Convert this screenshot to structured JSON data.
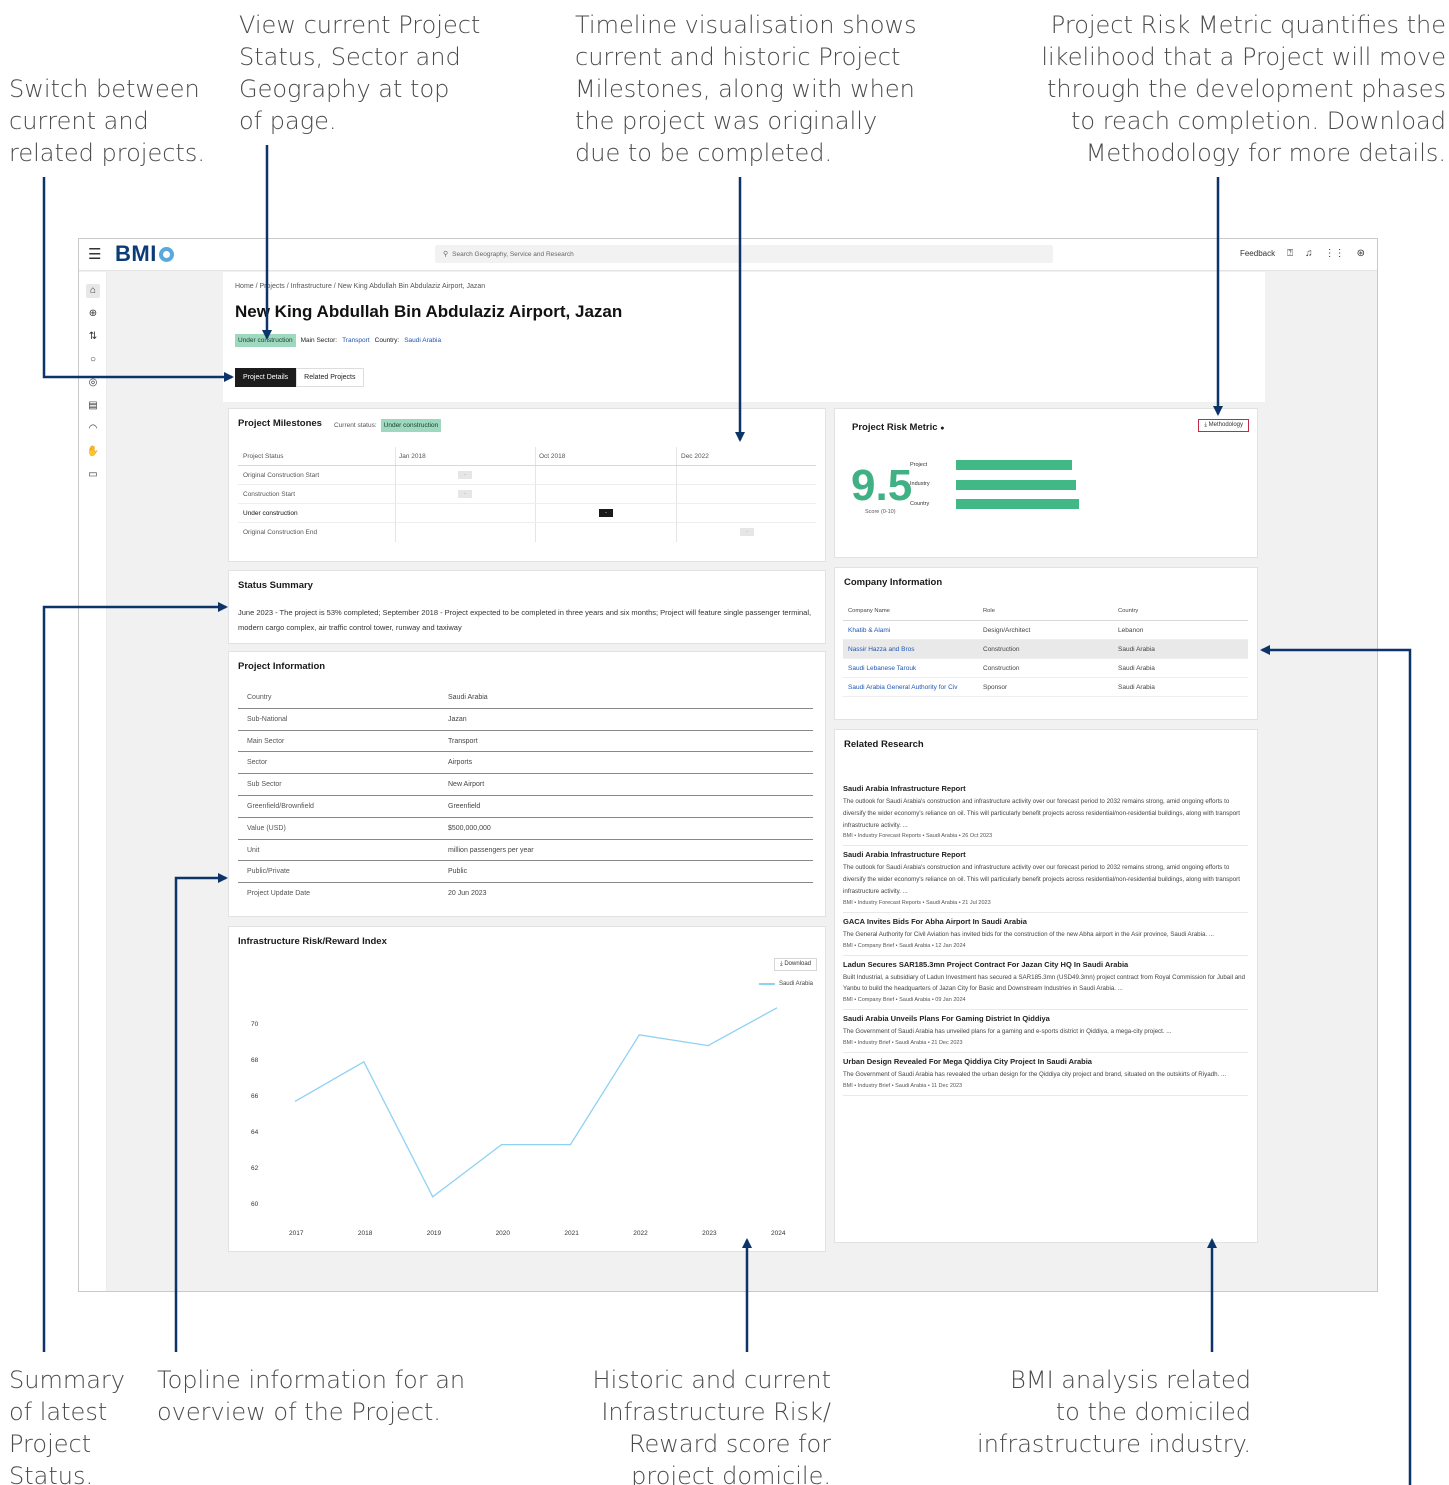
{
  "annotations": {
    "switch": "Switch between\ncurrent and\nrelated projects.",
    "view_status": "View current Project\nStatus, Sector and\nGeography at top\nof page.",
    "timeline": "Timeline visualisation shows\ncurrent and historic Project\nMilestones, along with when\nthe project was originally\ndue to be completed.",
    "risk_metric": "Project Risk Metric quantifies the\nlikelihood that a Project will move\nthrough the development phases\nto reach completion. Download\nMethodology for more details.",
    "summary": "Summary\nof latest\nProject\nStatus.",
    "topline": "Topline information for an\noverview of the Project.",
    "historic": "Historic and current\nInfrastructure Risk/\nReward score for\nproject domicile.",
    "bmi_analysis": "BMI analysis related\nto the domiciled\ninfrastructure industry."
  },
  "topbar": {
    "logo": "BMI",
    "search_placeholder": "Search Geography, Service and Research",
    "feedback": "Feedback"
  },
  "header": {
    "breadcrumb": "Home  /  Projects  /  Infrastructure  /  New King Abdullah Bin Abdulaziz Airport, Jazan",
    "title": "New King Abdullah Bin Abdulaziz Airport, Jazan",
    "status_badge": "Under construction",
    "main_sector_label": "Main Sector:",
    "main_sector": "Transport",
    "country_label": "Country:",
    "country": "Saudi Arabia",
    "tabs": [
      "Project Details",
      "Related Projects"
    ]
  },
  "milestones": {
    "title": "Project Milestones",
    "current_status_label": "Current status:",
    "current_status": "Under construction",
    "col_header": "Project Status",
    "dates": [
      "Jan 2018",
      "Oct 2018",
      "Dec 2022"
    ],
    "rows": [
      "Original Construction Start",
      "Construction Start",
      "Under construction",
      "Original Construction End"
    ],
    "marker": "-"
  },
  "risk": {
    "title": "Project Risk Metric",
    "methodology": "Methodology",
    "score": "9.5",
    "score_caption": "Score (0-10)",
    "bars": [
      {
        "label": "Project",
        "value": 0.93
      },
      {
        "label": "Industry",
        "value": 0.96
      },
      {
        "label": "Country",
        "value": 0.98
      }
    ],
    "color": "#42b887"
  },
  "summary": {
    "title": "Status Summary",
    "text": "June 2023 - The project is 53% completed; September 2018 - Project expected to be completed in three years and six months; Project will feature single passenger terminal, modern cargo complex, air traffic control tower, runway and taxiway"
  },
  "project_info": {
    "title": "Project Information",
    "rows": [
      {
        "k": "Country",
        "v": "Saudi Arabia"
      },
      {
        "k": "Sub-National",
        "v": "Jazan"
      },
      {
        "k": "Main Sector",
        "v": "Transport"
      },
      {
        "k": "Sector",
        "v": "Airports"
      },
      {
        "k": "Sub Sector",
        "v": "New Airport"
      },
      {
        "k": "Greenfield/Brownfield",
        "v": "Greenfield"
      },
      {
        "k": "Value (USD)",
        "v": "$500,000,000"
      },
      {
        "k": "Unit",
        "v": "million passengers per year"
      },
      {
        "k": "Public/Private",
        "v": "Public"
      },
      {
        "k": "Project Update Date",
        "v": "20 Jun 2023"
      }
    ]
  },
  "company": {
    "title": "Company Information",
    "headers": [
      "Company Name",
      "Role",
      "Country"
    ],
    "rows": [
      {
        "name": "Khatib & Alami",
        "role": "Design/Architect",
        "country": "Lebanon"
      },
      {
        "name": "Nassir Hazza and Bros",
        "role": "Construction",
        "country": "Saudi Arabia"
      },
      {
        "name": "Saudi Lebanese Tarouk",
        "role": "Construction",
        "country": "Saudi Arabia"
      },
      {
        "name": "Saudi Arabia General Authority for Civ",
        "role": "Sponsor",
        "country": "Saudi Arabia"
      }
    ]
  },
  "research": {
    "title": "Related Research",
    "items": [
      {
        "title": "Saudi Arabia Infrastructure Report",
        "body": "The outlook for Saudi Arabia's construction and infrastructure activity over our forecast period to 2032 remains strong, amid ongoing efforts to diversify the wider economy's reliance on oil. This will particularly benefit projects across residential/non-residential buildings, along with transport infrastructure activity. ...",
        "meta": "BMI  •  Industry Forecast Reports  •  Saudi Arabia  •  26 Oct 2023"
      },
      {
        "title": "Saudi Arabia Infrastructure Report",
        "body": "The outlook for Saudi Arabia's construction and infrastructure activity over our forecast period to 2032 remains strong, amid ongoing efforts to diversify the wider economy's reliance on oil. This will particularly benefit projects across residential/non-residential buildings, along with transport infrastructure activity. ...",
        "meta": "BMI  •  Industry Forecast Reports  •  Saudi Arabia  •  21 Jul 2023"
      },
      {
        "title": "GACA Invites Bids For Abha Airport In Saudi Arabia",
        "body": "The General Authority for Civil Aviation has invited bids for the construction of the new Abha airport in the Asir province, Saudi Arabia. ...",
        "meta": "BMI  •  Company Brief  •  Saudi Arabia  •  12 Jan 2024"
      },
      {
        "title": "Ladun Secures SAR185.3mn Project Contract For Jazan City HQ In Saudi Arabia",
        "body": "Built Industrial, a subsidiary of Ladun Investment has secured a SAR185.3mn (USD49.3mn) project contract from Royal Commission for Jubail and Yanbu to build the headquarters of Jazan City for Basic and Downstream Industries in Saudi Arabia. ...",
        "meta": "BMI  •  Company Brief  •  Saudi Arabia  •  09 Jan 2024"
      },
      {
        "title": "Saudi Arabia Unveils Plans For Gaming District In Qiddiya",
        "body": "The Government of Saudi Arabia has unveiled plans for a gaming and e-sports district in Qiddiya, a mega-city project. ...",
        "meta": "BMI  •  Industry Brief  •  Saudi Arabia  •  21 Dec 2023"
      },
      {
        "title": "Urban Design Revealed For Mega Qiddiya City Project In Saudi Arabia",
        "body": "The Government of Saudi Arabia has revealed the urban design for the Qiddiya city project and brand, situated on the outskirts of Riyadh. ...",
        "meta": "BMI  •  Industry Brief  •  Saudi Arabia  •  11 Dec 2023"
      }
    ]
  },
  "index_chart": {
    "title": "Infrastructure Risk/Reward Index",
    "download": "Download"
  },
  "chart_data": {
    "type": "line",
    "title": "Infrastructure Risk/Reward Index",
    "xlabel": "",
    "ylabel": "",
    "x": [
      2017,
      2018,
      2019,
      2020,
      2021,
      2022,
      2023,
      2024
    ],
    "series": [
      {
        "name": "Saudi Arabia",
        "values": [
          65.7,
          67.9,
          60.4,
          63.3,
          63.3,
          69.4,
          68.8,
          70.9
        ]
      }
    ],
    "ylim": [
      59.5,
      71.5
    ],
    "yticks": [
      60,
      62,
      64,
      66,
      68,
      70
    ],
    "grid": false,
    "legend": "top-right",
    "color": "#8fd1f3"
  }
}
